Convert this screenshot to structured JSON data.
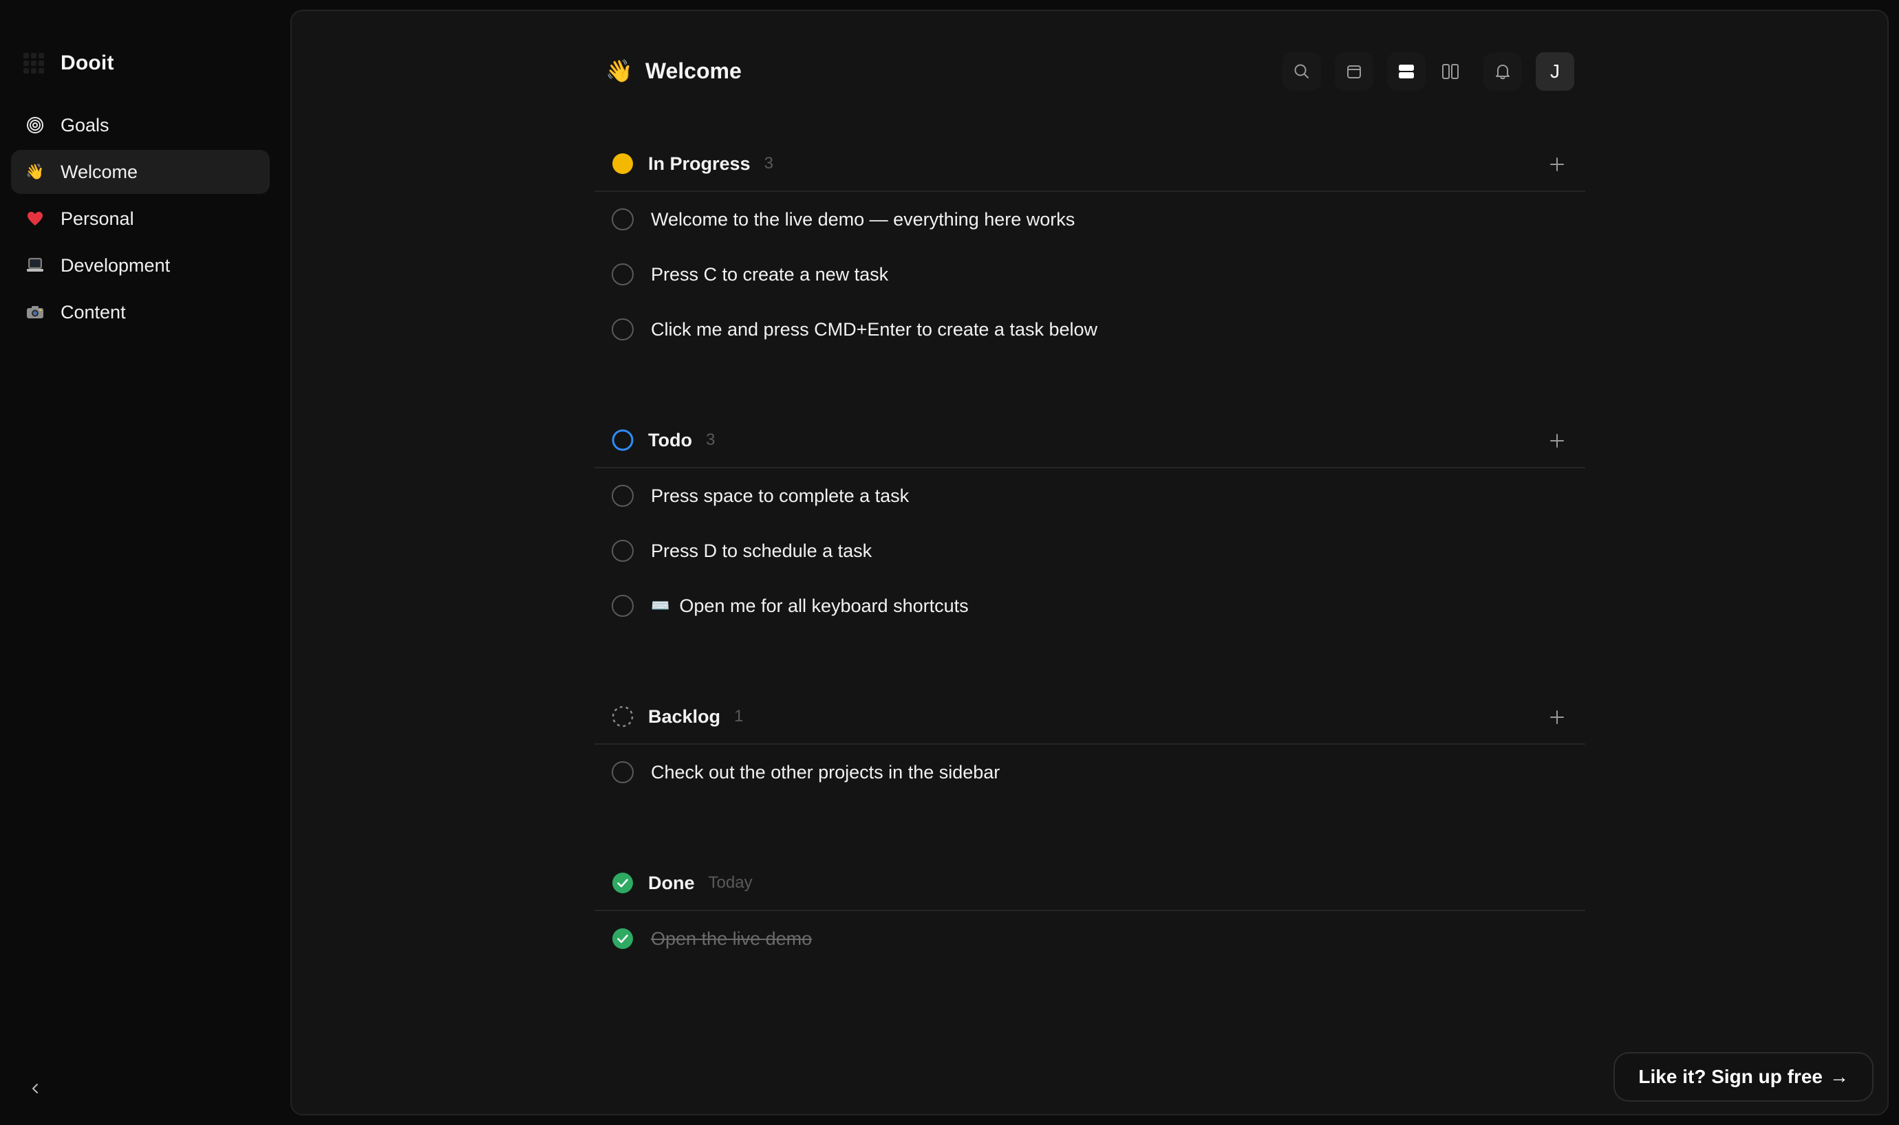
{
  "app": {
    "name": "Dooit"
  },
  "sidebar": {
    "items": [
      {
        "label": "Goals",
        "icon": "target-icon"
      },
      {
        "label": "Welcome",
        "icon": "waving-hand-icon",
        "emoji": "👋",
        "active": true
      },
      {
        "label": "Personal",
        "icon": "heart-icon",
        "emoji": "❤️"
      },
      {
        "label": "Development",
        "icon": "laptop-icon",
        "emoji": "💻"
      },
      {
        "label": "Content",
        "icon": "camera-icon",
        "emoji": "📸"
      }
    ]
  },
  "header": {
    "emoji": "👋",
    "title": "Welcome",
    "avatar_initial": "J",
    "toolbar": [
      "search-icon",
      "calendar-icon",
      "list-view-icon",
      "board-view-icon",
      "bell-icon"
    ]
  },
  "groups": [
    {
      "name": "In Progress",
      "count": "3",
      "status": "in-progress",
      "color": "#F5B800",
      "tasks": [
        {
          "text": "Welcome to the live demo — everything here works"
        },
        {
          "text": "Press C to create a new task"
        },
        {
          "text": "Click me and press CMD+Enter to create a task below"
        }
      ]
    },
    {
      "name": "Todo",
      "count": "3",
      "status": "todo",
      "color": "#2F8CF5",
      "tasks": [
        {
          "text": "Press space to complete a task"
        },
        {
          "text": "Press D to schedule a task"
        },
        {
          "text": "Open me for all keyboard shortcuts",
          "emoji": "⌨️"
        }
      ]
    },
    {
      "name": "Backlog",
      "count": "1",
      "status": "backlog",
      "color": "#8a8a8a",
      "tasks": [
        {
          "text": "Check out the other projects in the sidebar"
        }
      ]
    },
    {
      "name": "Done",
      "count": "Today",
      "status": "done",
      "color": "#2EAA63",
      "tasks": [
        {
          "text": "Open the live demo",
          "done": true
        }
      ]
    }
  ],
  "cta": {
    "label": "Like it? Sign up free",
    "arrow": "→"
  }
}
